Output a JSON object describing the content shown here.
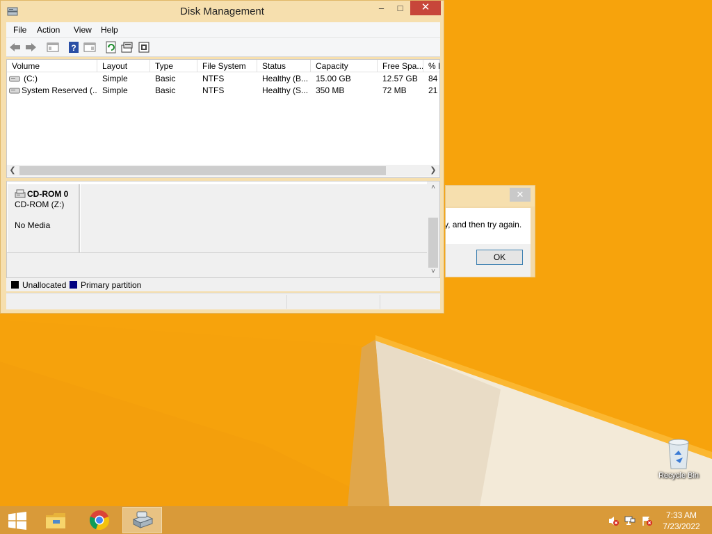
{
  "window": {
    "title": "Disk Management",
    "min_glyph": "–",
    "max_glyph": "□",
    "close_glyph": "✕"
  },
  "menu": [
    "File",
    "Action",
    "View",
    "Help"
  ],
  "toolbar": [
    "back-icon",
    "forward-icon",
    "show-hide-console-tree-icon",
    "help-icon",
    "properties-pane-icon",
    "refresh-icon",
    "rescan-disks-icon",
    "disk-properties-icon"
  ],
  "list": {
    "columns": [
      "Volume",
      "Layout",
      "Type",
      "File System",
      "Status",
      "Capacity",
      "Free Spa...",
      "% F"
    ],
    "rows": [
      [
        "(C:)",
        "Simple",
        "Basic",
        "NTFS",
        "Healthy (B...",
        "15.00 GB",
        "12.57 GB",
        "84"
      ],
      [
        "System Reserved (...",
        "Simple",
        "Basic",
        "NTFS",
        "Healthy (S...",
        "350 MB",
        "72 MB",
        "21"
      ]
    ],
    "scroll_left": "❮",
    "scroll_right": "❯"
  },
  "disk": {
    "name": "CD-ROM 0",
    "sub": "CD-ROM (Z:)",
    "media": "No Media",
    "scroll_up": "˄",
    "scroll_down": "˅"
  },
  "legend": [
    {
      "label": "Unallocated",
      "color": "#000000"
    },
    {
      "label": "Primary partition",
      "color": "#000080"
    }
  ],
  "dialog": {
    "message": "y, and then try again.",
    "ok": "OK",
    "close_glyph": "✕"
  },
  "desktop": {
    "recycle_bin": "Recycle Bin"
  },
  "taskbar": {
    "time": "7:33 AM",
    "date": "7/23/2022",
    "apps": [
      "start-icon",
      "file-explorer-icon",
      "chrome-icon",
      "disk-management-icon"
    ]
  },
  "colors": {
    "accent": "#f7a30c",
    "taskbar": "#d99a39",
    "close_button": "#c7463a"
  }
}
